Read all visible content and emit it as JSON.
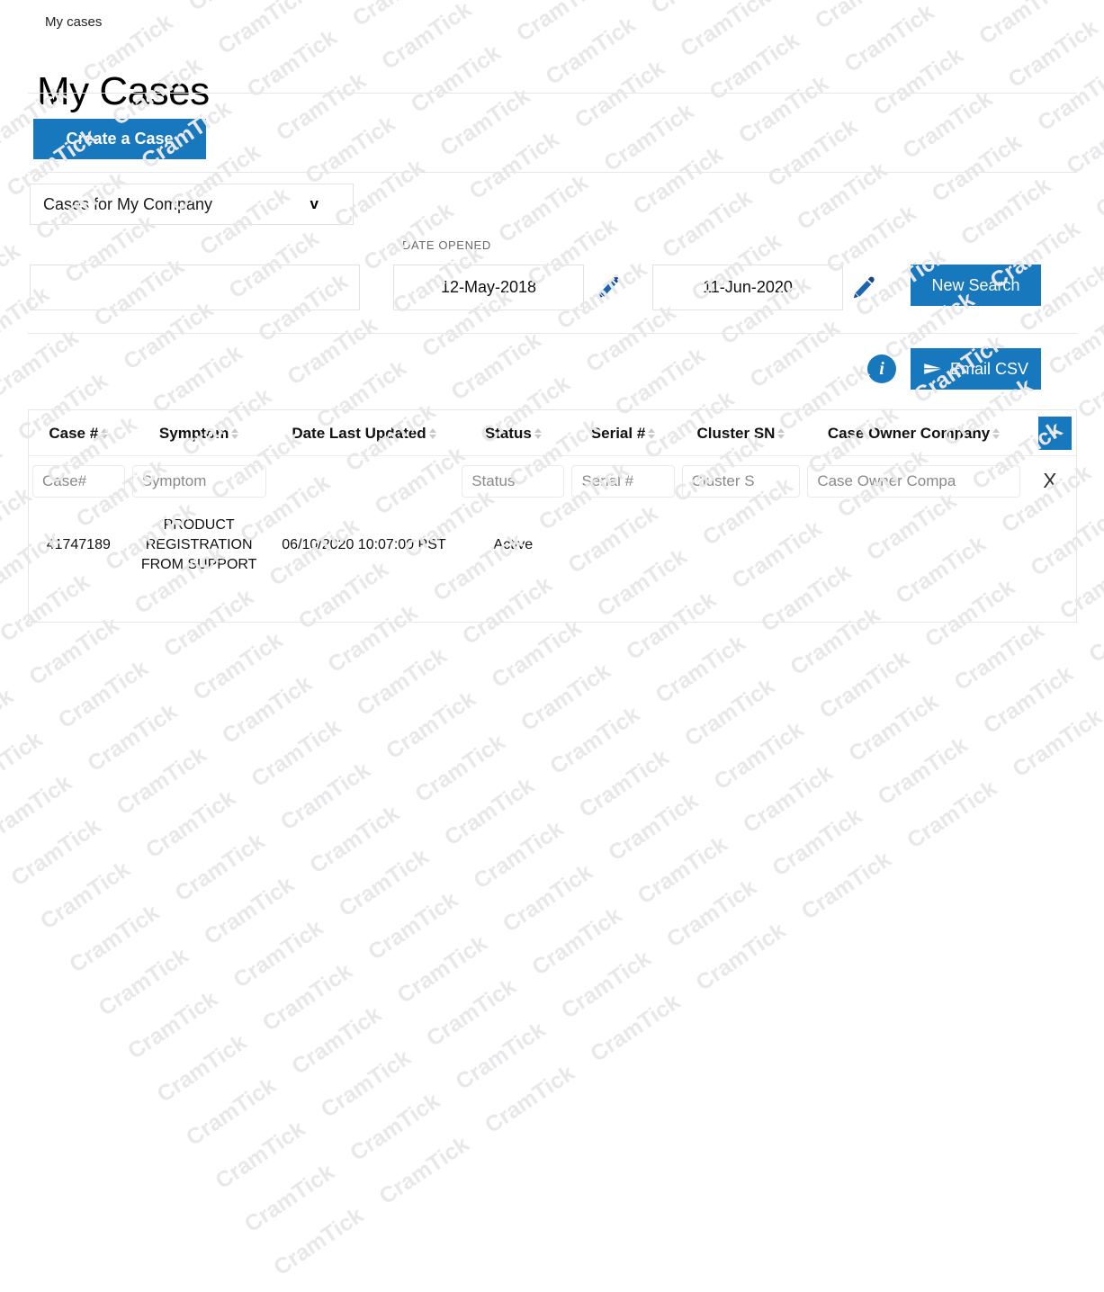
{
  "breadcrumb": "My cases",
  "page_title": "My Cases",
  "colors": {
    "primary_blue": "#1878be",
    "rule_gray": "#e6e6e6",
    "placeholder_gray": "#8a8a8a"
  },
  "toolbar": {
    "create_case_label": "Create a Case"
  },
  "filters": {
    "scope_dropdown": {
      "selected": "Cases for My Company",
      "caret": "v"
    },
    "keyword_input_value": "",
    "keyword_input_placeholder": "",
    "date_opened_label": "DATE OPENED",
    "date_from": "12-May-2018",
    "date_to": "11-Jun-2020",
    "edit_from_icon": "pencil-icon",
    "edit_to_icon": "pencil-icon",
    "new_search_label": "New Search"
  },
  "actions": {
    "info_icon_label": "i",
    "email_csv_label": "Email CSV",
    "email_csv_icon": "send-icon"
  },
  "table": {
    "add_column_label": "+",
    "clear_filters_label": "X",
    "columns": [
      {
        "label": "Case #",
        "sortable": true,
        "filter_placeholder": "Case#"
      },
      {
        "label": "Symptom",
        "sortable": true,
        "filter_placeholder": "Symptom"
      },
      {
        "label": "Date Last Updated",
        "sortable": true,
        "filter_placeholder": ""
      },
      {
        "label": "Status",
        "sortable": true,
        "filter_placeholder": "Status"
      },
      {
        "label": "Serial #",
        "sortable": true,
        "filter_placeholder": "Serial #"
      },
      {
        "label": "Cluster SN",
        "sortable": true,
        "filter_placeholder": "Cluster S"
      },
      {
        "label": "Case Owner Company",
        "sortable": true,
        "filter_placeholder": "Case Owner Compa"
      }
    ],
    "rows": [
      {
        "case_number": "41747189",
        "symptom": "PRODUCT REGISTRATION FROM SUPPORT",
        "date_last_updated": "06/10/2020 10:07:00 PST",
        "status": "Active",
        "serial_number": "",
        "cluster_sn": "",
        "case_owner_company": ""
      }
    ]
  },
  "watermark": {
    "text": "CramTick"
  }
}
